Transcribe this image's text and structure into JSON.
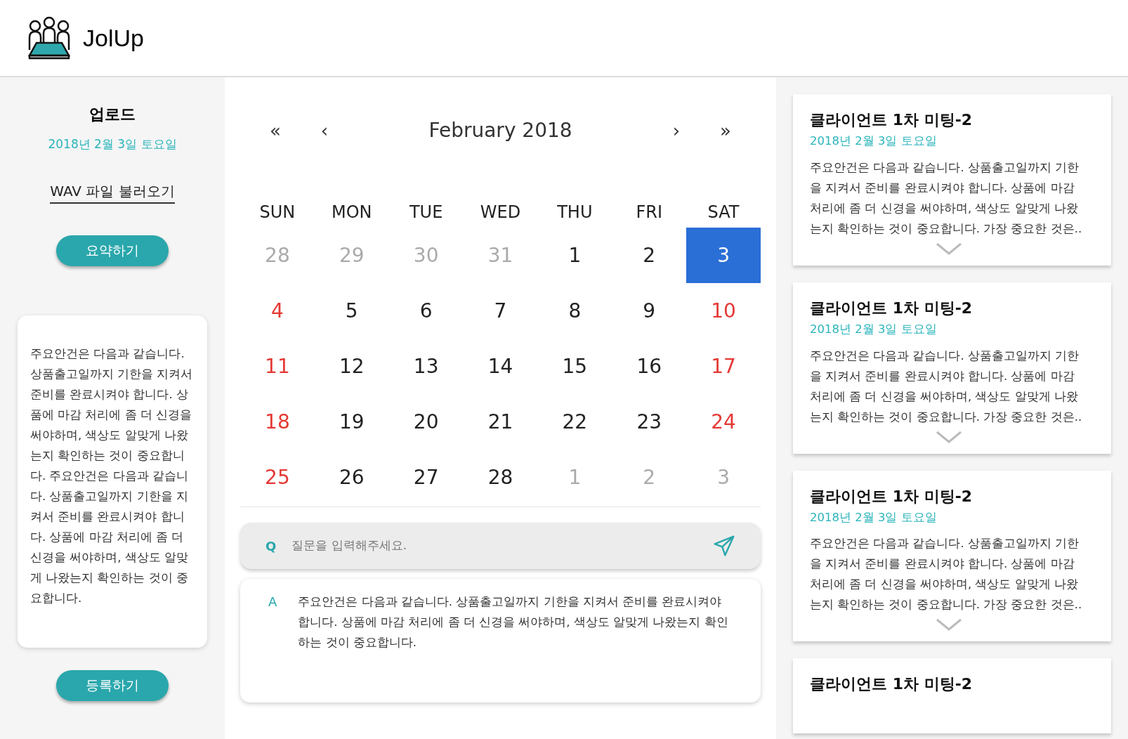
{
  "app": {
    "name": "JolUp"
  },
  "upload": {
    "title": "업로드",
    "date": "2018년 2월 3일 토요일",
    "file_link": "WAV 파일 불러오기",
    "summarize_button": "요약하기",
    "summary": "주요안건은 다음과 같습니다.  상품출고일까지 기한을 지켜서 준비를 완료시켜야 합니다. 상품에 마감 처리에 좀 더 신경을 써야하며, 색상도 알맞게 나왔는지 확인하는 것이 중요합니다. 주요안건은 다음과 같습니다.  상품출고일까지 기한을 지켜서 준비를 완료시켜야 합니다. 상품에 마감 처리에 좀 더 신경을 써야하며, 색상도 알맞게 나왔는지 확인하는 것이 중요합니다.",
    "register_button": "등록하기"
  },
  "calendar": {
    "nav": [
      "«",
      "‹",
      "›",
      "»"
    ],
    "month": "February 2018",
    "weekdays": [
      "SUN",
      "MON",
      "TUE",
      "WED",
      "THU",
      "FRI",
      "SAT"
    ],
    "weeks": [
      [
        {
          "day": "28",
          "muted": true,
          "selected": false
        },
        {
          "day": "29",
          "muted": true,
          "selected": false
        },
        {
          "day": "30",
          "muted": true,
          "selected": false
        },
        {
          "day": "31",
          "muted": true,
          "selected": false
        },
        {
          "day": "1",
          "muted": false,
          "selected": false
        },
        {
          "day": "2",
          "muted": false,
          "selected": false
        },
        {
          "day": "3",
          "muted": false,
          "selected": true
        }
      ],
      [
        {
          "day": "4",
          "muted": false,
          "selected": false
        },
        {
          "day": "5",
          "muted": false,
          "selected": false
        },
        {
          "day": "6",
          "muted": false,
          "selected": false
        },
        {
          "day": "7",
          "muted": false,
          "selected": false
        },
        {
          "day": "8",
          "muted": false,
          "selected": false
        },
        {
          "day": "9",
          "muted": false,
          "selected": false
        },
        {
          "day": "10",
          "muted": false,
          "selected": false
        }
      ],
      [
        {
          "day": "11",
          "muted": false,
          "selected": false
        },
        {
          "day": "12",
          "muted": false,
          "selected": false
        },
        {
          "day": "13",
          "muted": false,
          "selected": false
        },
        {
          "day": "14",
          "muted": false,
          "selected": false
        },
        {
          "day": "15",
          "muted": false,
          "selected": false
        },
        {
          "day": "16",
          "muted": false,
          "selected": false
        },
        {
          "day": "17",
          "muted": false,
          "selected": false
        }
      ],
      [
        {
          "day": "18",
          "muted": false,
          "selected": false
        },
        {
          "day": "19",
          "muted": false,
          "selected": false
        },
        {
          "day": "20",
          "muted": false,
          "selected": false
        },
        {
          "day": "21",
          "muted": false,
          "selected": false
        },
        {
          "day": "22",
          "muted": false,
          "selected": false
        },
        {
          "day": "23",
          "muted": false,
          "selected": false
        },
        {
          "day": "24",
          "muted": false,
          "selected": false
        }
      ],
      [
        {
          "day": "25",
          "muted": false,
          "selected": false
        },
        {
          "day": "26",
          "muted": false,
          "selected": false
        },
        {
          "day": "27",
          "muted": false,
          "selected": false
        },
        {
          "day": "28",
          "muted": false,
          "selected": false
        },
        {
          "day": "1",
          "muted": true,
          "selected": false
        },
        {
          "day": "2",
          "muted": true,
          "selected": false
        },
        {
          "day": "3",
          "muted": true,
          "selected": false
        }
      ]
    ]
  },
  "question": {
    "label": "Q",
    "placeholder": "질문을 입력해주세요."
  },
  "answer": {
    "label": "A",
    "text": "주요안건은 다음과 같습니다.  상품출고일까지 기한을 지켜서 준비를 완료시켜야 합니다. 상품에 마감 처리에 좀 더 신경을 써야하며, 색상도 알맞게 나왔는지 확인하는 것이 중요합니다."
  },
  "meetings": [
    {
      "title": "클라이언트 1차 미팅-2",
      "date": "2018년 2월 3일 토요일",
      "summary": "주요안건은 다음과 같습니다.  상품출고일까지 기한을 지켜서 준비를 완료시켜야 합니다. 상품에 마감 처리에 좀 더 신경을 써야하며, 색상도 알맞게 나왔는지 확인하는 것이 중요합니다. 가장 중요한 것은.."
    },
    {
      "title": "클라이언트 1차 미팅-2",
      "date": "2018년 2월 3일 토요일",
      "summary": "주요안건은 다음과 같습니다.  상품출고일까지 기한을 지켜서 준비를 완료시켜야 합니다. 상품에 마감 처리에 좀 더 신경을 써야하며, 색상도 알맞게 나왔는지 확인하는 것이 중요합니다. 가장 중요한 것은.."
    },
    {
      "title": "클라이언트 1차 미팅-2",
      "date": "2018년 2월 3일 토요일",
      "summary": "주요안건은 다음과 같습니다.  상품출고일까지 기한을 지켜서 준비를 완료시켜야 합니다. 상품에 마감 처리에 좀 더 신경을 써야하며, 색상도 알맞게 나왔는지 확인하는 것이 중요합니다. 가장 중요한 것은.."
    },
    {
      "title": "클라이언트 1차 미팅-2"
    }
  ]
}
